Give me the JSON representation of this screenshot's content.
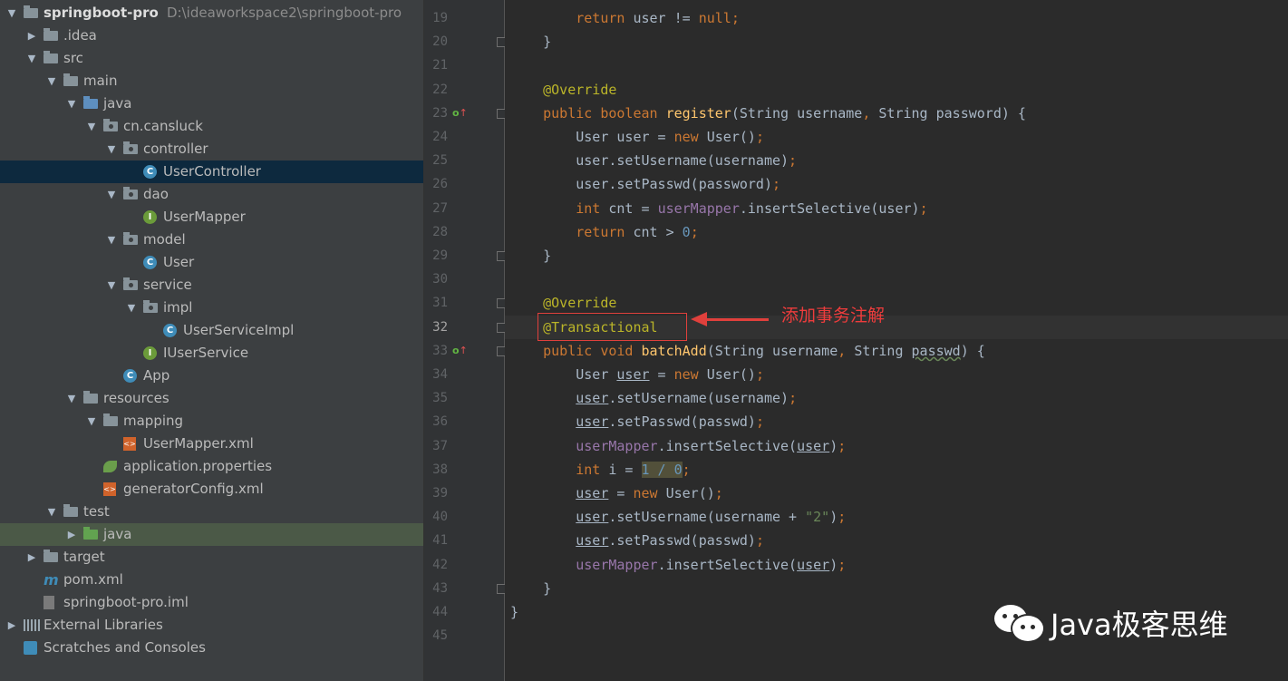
{
  "project_tree": {
    "items": [
      {
        "label": "springboot-pro",
        "path": "D:\\ideaworkspace2\\springboot-pro",
        "icon": "folder-icon",
        "expanded": true
      },
      {
        "label": ".idea",
        "icon": "folder-icon",
        "expanded": false
      },
      {
        "label": "src",
        "icon": "folder-icon",
        "expanded": true
      },
      {
        "label": "main",
        "icon": "folder-icon",
        "expanded": true
      },
      {
        "label": "java",
        "icon": "source-folder-icon",
        "expanded": true
      },
      {
        "label": "cn.cansluck",
        "icon": "package-icon",
        "expanded": true
      },
      {
        "label": "controller",
        "icon": "package-icon",
        "expanded": true
      },
      {
        "label": "UserController",
        "icon": "class-icon",
        "selected": true
      },
      {
        "label": "dao",
        "icon": "package-icon",
        "expanded": true
      },
      {
        "label": "UserMapper",
        "icon": "interface-icon"
      },
      {
        "label": "model",
        "icon": "package-icon",
        "expanded": true
      },
      {
        "label": "User",
        "icon": "class-icon"
      },
      {
        "label": "service",
        "icon": "package-icon",
        "expanded": true
      },
      {
        "label": "impl",
        "icon": "package-icon",
        "expanded": true
      },
      {
        "label": "UserServiceImpl",
        "icon": "class-icon"
      },
      {
        "label": "IUserService",
        "icon": "interface-icon"
      },
      {
        "label": "App",
        "icon": "spring-boot-class-icon"
      },
      {
        "label": "resources",
        "icon": "resources-folder-icon",
        "expanded": true
      },
      {
        "label": "mapping",
        "icon": "folder-icon",
        "expanded": true
      },
      {
        "label": "UserMapper.xml",
        "icon": "xml-file-icon"
      },
      {
        "label": "application.properties",
        "icon": "spring-properties-icon"
      },
      {
        "label": "generatorConfig.xml",
        "icon": "xml-file-icon"
      },
      {
        "label": "test",
        "icon": "folder-icon",
        "expanded": true
      },
      {
        "label": "java",
        "icon": "test-source-folder-icon",
        "expanded": false,
        "highlighted": true
      },
      {
        "label": "target",
        "icon": "folder-icon",
        "expanded": false
      },
      {
        "label": "pom.xml",
        "icon": "maven-icon"
      },
      {
        "label": "springboot-pro.iml",
        "icon": "iml-file-icon"
      },
      {
        "label": "External Libraries",
        "icon": "libraries-icon",
        "expanded": false
      },
      {
        "label": "Scratches and Consoles",
        "icon": "scratches-icon"
      }
    ]
  },
  "editor": {
    "current_line": "32",
    "lines": [
      {
        "num": "19",
        "tokens": [
          [
            "        ",
            ""
          ],
          [
            "return ",
            "kw"
          ],
          [
            "user != ",
            ""
          ],
          [
            "null",
            "kw"
          ],
          [
            ";",
            "kw"
          ]
        ]
      },
      {
        "num": "20",
        "fold": true,
        "tokens": [
          [
            "    }",
            ""
          ]
        ]
      },
      {
        "num": "21",
        "tokens": []
      },
      {
        "num": "22",
        "tokens": [
          [
            "    ",
            ""
          ],
          [
            "@Override",
            "ann"
          ]
        ]
      },
      {
        "num": "23",
        "override": true,
        "fold": true,
        "tokens": [
          [
            "    ",
            ""
          ],
          [
            "public boolean ",
            "kw"
          ],
          [
            "register",
            "fn"
          ],
          [
            "(String username",
            ""
          ],
          [
            ", ",
            "kw"
          ],
          [
            "String password) {",
            ""
          ]
        ]
      },
      {
        "num": "24",
        "tokens": [
          [
            "        User user = ",
            ""
          ],
          [
            "new ",
            "kw"
          ],
          [
            "User()",
            ""
          ],
          [
            ";",
            "kw"
          ]
        ]
      },
      {
        "num": "25",
        "tokens": [
          [
            "        user.setUsername(username)",
            ""
          ],
          [
            ";",
            "kw"
          ]
        ]
      },
      {
        "num": "26",
        "tokens": [
          [
            "        user.setPasswd(password)",
            ""
          ],
          [
            ";",
            "kw"
          ]
        ]
      },
      {
        "num": "27",
        "tokens": [
          [
            "        ",
            ""
          ],
          [
            "int ",
            "kw"
          ],
          [
            "cnt = ",
            ""
          ],
          [
            "userMapper",
            "fld"
          ],
          [
            ".insertSelective(user)",
            ""
          ],
          [
            ";",
            "kw"
          ]
        ]
      },
      {
        "num": "28",
        "tokens": [
          [
            "        ",
            ""
          ],
          [
            "return ",
            "kw"
          ],
          [
            "cnt > ",
            ""
          ],
          [
            "0",
            "num"
          ],
          [
            ";",
            "kw"
          ]
        ]
      },
      {
        "num": "29",
        "fold": true,
        "tokens": [
          [
            "    }",
            ""
          ]
        ]
      },
      {
        "num": "30",
        "tokens": []
      },
      {
        "num": "31",
        "fold": true,
        "tokens": [
          [
            "    ",
            ""
          ],
          [
            "@Override",
            "ann"
          ]
        ]
      },
      {
        "num": "32",
        "fold": true,
        "tokens": [
          [
            "    ",
            ""
          ],
          [
            "@Transactional",
            "ann"
          ]
        ]
      },
      {
        "num": "33",
        "override": true,
        "fold": true,
        "tokens": [
          [
            "    ",
            ""
          ],
          [
            "public void ",
            "kw"
          ],
          [
            "batchAdd",
            "fn"
          ],
          [
            "(String username",
            ""
          ],
          [
            ", ",
            "kw"
          ],
          [
            "String ",
            ""
          ],
          [
            "passwd",
            "wavy"
          ],
          [
            ") {",
            ""
          ]
        ]
      },
      {
        "num": "34",
        "tokens": [
          [
            "        User ",
            ""
          ],
          [
            "user",
            "lv"
          ],
          [
            " = ",
            ""
          ],
          [
            "new ",
            "kw"
          ],
          [
            "User()",
            ""
          ],
          [
            ";",
            "kw"
          ]
        ]
      },
      {
        "num": "35",
        "tokens": [
          [
            "        ",
            ""
          ],
          [
            "user",
            "lv"
          ],
          [
            ".setUsername(username)",
            ""
          ],
          [
            ";",
            "kw"
          ]
        ]
      },
      {
        "num": "36",
        "tokens": [
          [
            "        ",
            ""
          ],
          [
            "user",
            "lv"
          ],
          [
            ".setPasswd(passwd)",
            ""
          ],
          [
            ";",
            "kw"
          ]
        ]
      },
      {
        "num": "37",
        "tokens": [
          [
            "        ",
            ""
          ],
          [
            "userMapper",
            "fld"
          ],
          [
            ".insertSelective(",
            ""
          ],
          [
            "user",
            "lv"
          ],
          [
            ")",
            ""
          ],
          [
            ";",
            "kw"
          ]
        ]
      },
      {
        "num": "38",
        "tokens": [
          [
            "        ",
            ""
          ],
          [
            "int ",
            "kw"
          ],
          [
            "i = ",
            ""
          ],
          [
            "1 / 0",
            "selnum"
          ],
          [
            ";",
            "kw"
          ]
        ]
      },
      {
        "num": "39",
        "tokens": [
          [
            "        ",
            ""
          ],
          [
            "user",
            "lv"
          ],
          [
            " = ",
            ""
          ],
          [
            "new ",
            "kw"
          ],
          [
            "User()",
            ""
          ],
          [
            ";",
            "kw"
          ]
        ]
      },
      {
        "num": "40",
        "tokens": [
          [
            "        ",
            ""
          ],
          [
            "user",
            "lv"
          ],
          [
            ".setUsername(username + ",
            ""
          ],
          [
            "\"2\"",
            "str"
          ],
          [
            ")",
            ""
          ],
          [
            ";",
            "kw"
          ]
        ]
      },
      {
        "num": "41",
        "tokens": [
          [
            "        ",
            ""
          ],
          [
            "user",
            "lv"
          ],
          [
            ".setPasswd(passwd)",
            ""
          ],
          [
            ";",
            "kw"
          ]
        ]
      },
      {
        "num": "42",
        "tokens": [
          [
            "        ",
            ""
          ],
          [
            "userMapper",
            "fld"
          ],
          [
            ".insertSelective(",
            ""
          ],
          [
            "user",
            "lv"
          ],
          [
            ")",
            ""
          ],
          [
            ";",
            "kw"
          ]
        ]
      },
      {
        "num": "43",
        "fold": true,
        "tokens": [
          [
            "    }",
            ""
          ]
        ]
      },
      {
        "num": "44",
        "tokens": [
          [
            "}",
            ""
          ]
        ]
      },
      {
        "num": "45",
        "tokens": []
      }
    ]
  },
  "annotation": {
    "note": "添加事务注解",
    "color": "#e0403c"
  },
  "watermark": {
    "text": "Java极客思维",
    "icon": "wechat-icon"
  },
  "colors": {
    "keyword": "#cc7832",
    "annotation": "#bbb529",
    "method": "#ffc66d",
    "field": "#9876aa",
    "number": "#6897bb",
    "string": "#6a8759",
    "default": "#a9b7c6",
    "selected_row": "#0d293e"
  }
}
